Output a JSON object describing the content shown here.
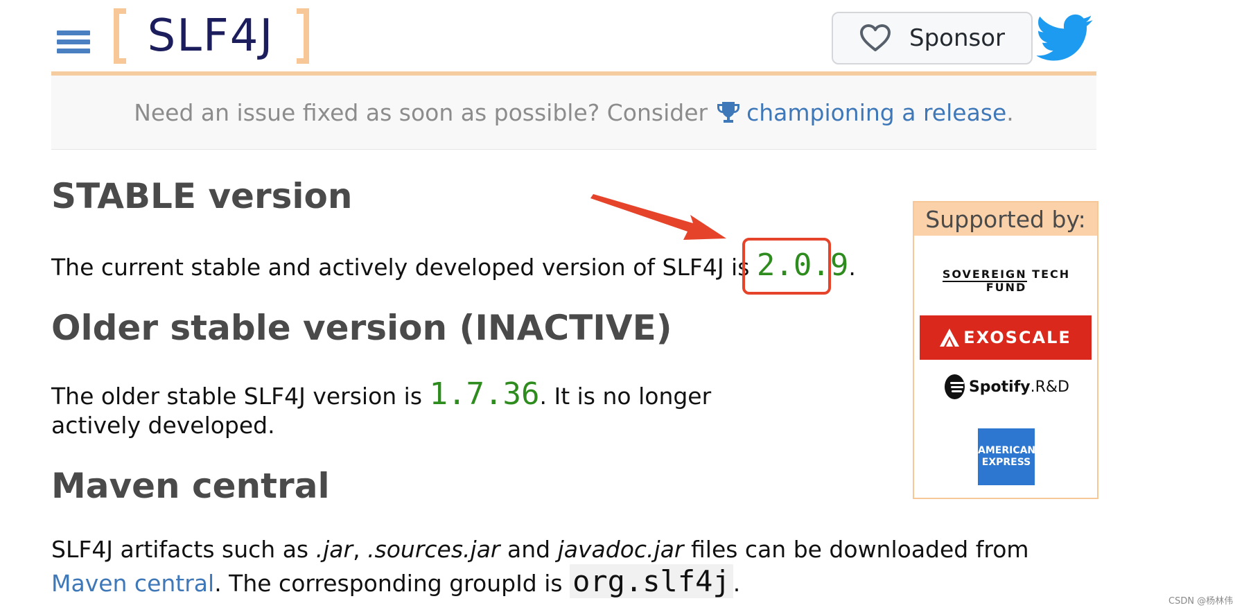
{
  "header": {
    "logo_text": "SLF4J",
    "sponsor_label": "Sponsor",
    "icons": {
      "menu": "hamburger-icon",
      "sponsor": "heart-icon",
      "twitter": "twitter-bird-icon"
    },
    "colors": {
      "logo_text": "#1b1d5c",
      "logo_bracket": "#f8c797",
      "menu": "#4a7fc1",
      "twitter": "#1d9bf0"
    }
  },
  "notice": {
    "text": "Need an issue fixed as soon as possible? Consider",
    "link_text": "championing a release",
    "suffix": ".",
    "icon": "trophy-icon"
  },
  "sections": {
    "stable": {
      "heading": "STABLE version",
      "text": "The current stable and actively developed version of SLF4J is",
      "version": "2.0.9",
      "suffix": "."
    },
    "older": {
      "heading": "Older stable version (INACTIVE)",
      "text": "The older stable SLF4J version is",
      "version": "1.7.36",
      "suffix": ". It is no longer actively developed."
    },
    "maven": {
      "heading": "Maven central",
      "text_1": "SLF4J artifacts such as",
      "jar": ".jar",
      "comma": ",",
      "sources_jar": ".sources.jar",
      "and": "and",
      "javadoc_jar": "javadoc.jar",
      "text_2": "files can be downloaded from",
      "link_text": "Maven central",
      "text_3": ". The corresponding groupId is",
      "group_id": "org.slf4j",
      "end": "."
    }
  },
  "sponsors": {
    "heading": "Supported by:",
    "items": [
      {
        "name": "SOVEREIGN TECH FUND",
        "part_a": "SOVEREIGN",
        "part_b": "TECH FUND"
      },
      {
        "name": "EXOSCALE"
      },
      {
        "name": "Spotify R&D",
        "brand": "Spotify",
        "suffix": ".R&D"
      },
      {
        "name": "AMERICAN EXPRESS",
        "line_1": "AMERICAN",
        "line_2": "EXPRESS"
      }
    ]
  },
  "annotation": {
    "highlight_color": "#e5432a"
  },
  "watermark": "CSDN @杨林伟",
  "colors": {
    "version_green": "#2e8b1e",
    "link_blue": "#3f78b8",
    "heading_gray": "#4a4a4a"
  }
}
